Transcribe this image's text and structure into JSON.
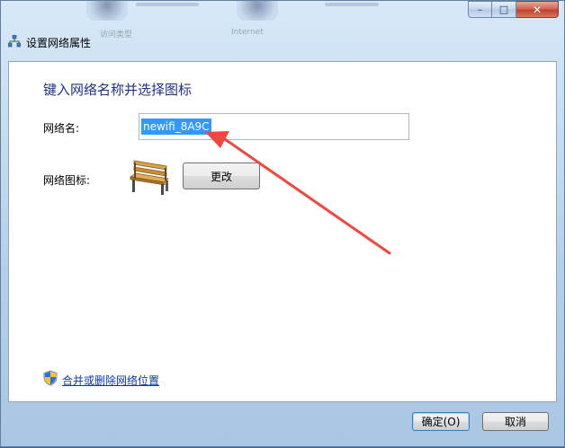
{
  "window": {
    "title": "设置网络属性",
    "controls": {
      "minimize": "–",
      "maximize": "□",
      "close": "✕"
    },
    "background_hint": {
      "left_label": "访问类型",
      "right_label": "Internet"
    }
  },
  "dialog": {
    "heading": "键入网络名称并选择图标",
    "network_name_label": "网络名:",
    "network_name_value": "newifi_8A9C",
    "network_icon_label": "网络图标:",
    "change_button": "更改",
    "merge_link": "合并或删除网络位置",
    "ok_button": "确定(O)",
    "cancel_button": "取消"
  },
  "colors": {
    "heading": "#1e3287",
    "selection": "#3399ff",
    "annotation_arrow": "#f0483e"
  },
  "icons": [
    "network-icon",
    "bench-icon",
    "shield-icon",
    "red-arrow-annotation"
  ]
}
